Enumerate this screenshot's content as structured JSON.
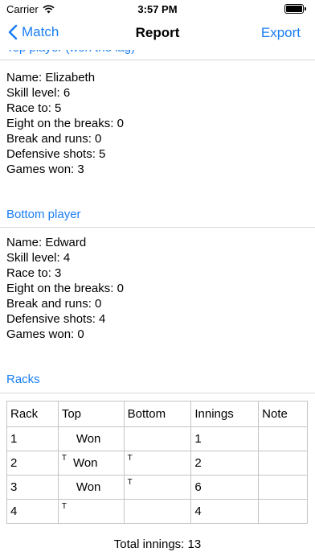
{
  "status": {
    "carrier": "Carrier",
    "time": "3:57 PM"
  },
  "nav": {
    "back_label": "Match",
    "title": "Report",
    "export_label": "Export"
  },
  "top_player": {
    "header": "Top player (won the lag)",
    "lines": [
      "Name: Elizabeth",
      "Skill level: 6",
      "Race to: 5",
      "Eight on the breaks: 0",
      "Break and runs: 0",
      "Defensive shots: 5",
      "Games won: 3"
    ]
  },
  "bottom_player": {
    "header": "Bottom player",
    "lines": [
      "Name: Edward",
      "Skill level: 4",
      "Race to: 3",
      "Eight on the breaks: 0",
      "Break and runs: 0",
      "Defensive shots: 4",
      "Games won: 0"
    ]
  },
  "racks": {
    "header": "Racks",
    "columns": [
      "Rack",
      "Top",
      "Bottom",
      "Innings",
      "Note"
    ],
    "rows": [
      {
        "rack": "1",
        "top_mark": "",
        "top": "Won",
        "bottom_mark": "",
        "bottom": "",
        "innings": "1",
        "note": ""
      },
      {
        "rack": "2",
        "top_mark": "T",
        "top": "Won",
        "bottom_mark": "T",
        "bottom": "",
        "innings": "2",
        "note": ""
      },
      {
        "rack": "3",
        "top_mark": "",
        "top": "Won",
        "bottom_mark": "T",
        "bottom": "",
        "innings": "6",
        "note": ""
      },
      {
        "rack": "4",
        "top_mark": "T",
        "top": "",
        "bottom_mark": "",
        "bottom": "",
        "innings": "4",
        "note": ""
      }
    ]
  },
  "total_innings": "Total innings: 13",
  "colors": {
    "accent": "#1a7ef2",
    "divider": "#d8d8d8",
    "table_border": "#c4c4c4"
  }
}
